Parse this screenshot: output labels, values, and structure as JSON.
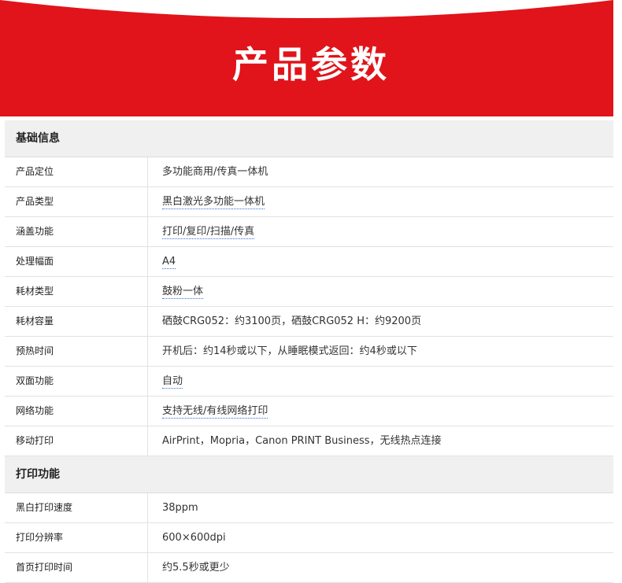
{
  "banner": {
    "title": "产品参数",
    "color": "#e0141a"
  },
  "sections": [
    {
      "title": "基础信息",
      "rows": [
        {
          "label": "产品定位",
          "value": "多功能商用/传真一体机"
        },
        {
          "label": "产品类型",
          "value": "黑白激光多功能一体机"
        },
        {
          "label": "涵盖功能",
          "value": "打印/复印/扫描/传真"
        },
        {
          "label": "处理幅面",
          "value": "A4"
        },
        {
          "label": "耗材类型",
          "value": "鼓粉一体"
        },
        {
          "label": "耗材容量",
          "value": "硒鼓CRG052：约3100页，硒鼓CRG052 H：约9200页"
        },
        {
          "label": "预热时间",
          "value": "开机后：约14秒或以下，从睡眠模式返回：约4秒或以下"
        },
        {
          "label": "双面功能",
          "value": "自动"
        },
        {
          "label": "网络功能",
          "value": "支持无线/有线网络打印"
        },
        {
          "label": "移动打印",
          "value": "AirPrint，Mopria，Canon PRINT Business，无线热点连接"
        }
      ]
    },
    {
      "title": "打印功能",
      "rows": [
        {
          "label": "黑白打印速度",
          "value": "38ppm"
        },
        {
          "label": "打印分辨率",
          "value": "600×600dpi"
        },
        {
          "label": "首页打印时间",
          "value": "约5.5秒或更少"
        }
      ]
    }
  ]
}
